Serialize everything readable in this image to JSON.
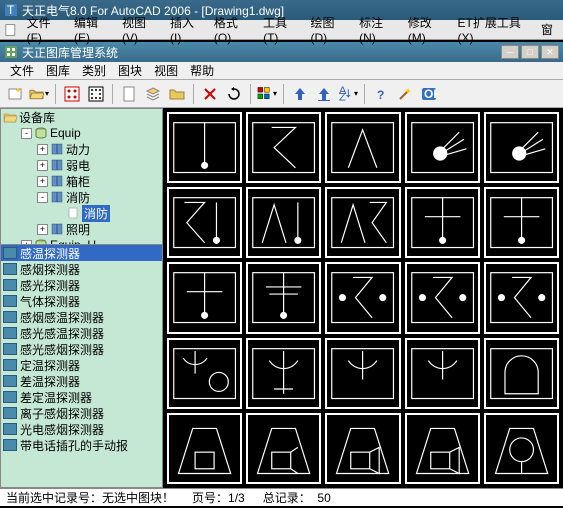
{
  "outer": {
    "title": "天正电气8.0 For AutoCAD 2006 - [Drawing1.dwg]",
    "menu": [
      "文件(F)",
      "编辑(E)",
      "视图(V)",
      "插入(I)",
      "格式(O)",
      "工具(T)",
      "绘图(D)",
      "标注(N)",
      "修改(M)",
      "ET扩展工具(X)",
      "窗"
    ]
  },
  "inner": {
    "title": "天正图库管理系统",
    "menu": [
      "文件",
      "图库",
      "类别",
      "图块",
      "视图",
      "帮助"
    ]
  },
  "tree": {
    "root": "设备库",
    "items": [
      {
        "label": "Equip",
        "indent": 1,
        "toggle": "-",
        "icon": "cyl"
      },
      {
        "label": "动力",
        "indent": 2,
        "toggle": "+",
        "icon": "book"
      },
      {
        "label": "弱电",
        "indent": 2,
        "toggle": "+",
        "icon": "book"
      },
      {
        "label": "箱柜",
        "indent": 2,
        "toggle": "+",
        "icon": "book"
      },
      {
        "label": "消防",
        "indent": 2,
        "toggle": "-",
        "icon": "book"
      },
      {
        "label": "消防",
        "indent": 3,
        "toggle": "",
        "icon": "page",
        "selected": true
      },
      {
        "label": "照明",
        "indent": 2,
        "toggle": "+",
        "icon": "book"
      },
      {
        "label": "Equip_U",
        "indent": 1,
        "toggle": "+",
        "icon": "cyl"
      }
    ]
  },
  "list": [
    "感温探测器",
    "感烟探测器",
    "感光探测器",
    "气体探测器",
    "感烟感温探测器",
    "感光感温探测器",
    "感光感烟探测器",
    "定温探测器",
    "差温探测器",
    "差定温探测器",
    "离子感烟探测器",
    "光电感烟探测器",
    "带电话插孔的手动报"
  ],
  "status": {
    "left": "当前选中记录号：无选中图块！",
    "page_label": "页号：",
    "page_value": "1/3",
    "total_label": "总记录：",
    "total_value": "50"
  }
}
